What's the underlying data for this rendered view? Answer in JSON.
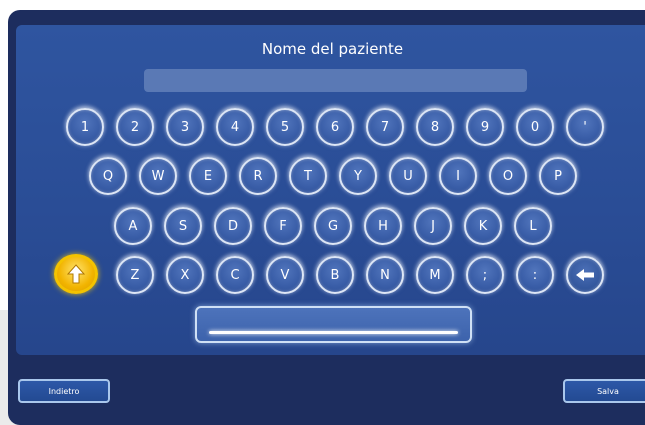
{
  "header": {
    "title": "Nome del paziente"
  },
  "name_field": {
    "value": ""
  },
  "keyboard": {
    "rows": [
      [
        "1",
        "2",
        "3",
        "4",
        "5",
        "6",
        "7",
        "8",
        "9",
        "0",
        "'"
      ],
      [
        "Q",
        "W",
        "E",
        "R",
        "T",
        "Y",
        "U",
        "I",
        "O",
        "P"
      ],
      [
        "A",
        "S",
        "D",
        "F",
        "G",
        "H",
        "J",
        "K",
        "L"
      ],
      [
        "Z",
        "X",
        "C",
        "V",
        "B",
        "N",
        "M",
        ";",
        ":"
      ]
    ],
    "shift_icon": "arrow-up-icon",
    "backspace_icon": "arrow-left-icon"
  },
  "footer": {
    "back_label": "Indietro",
    "save_label": "Salva"
  },
  "colors": {
    "accent": "#f4c300",
    "panel": "#2f55a0",
    "frame": "#1d2d5e"
  }
}
